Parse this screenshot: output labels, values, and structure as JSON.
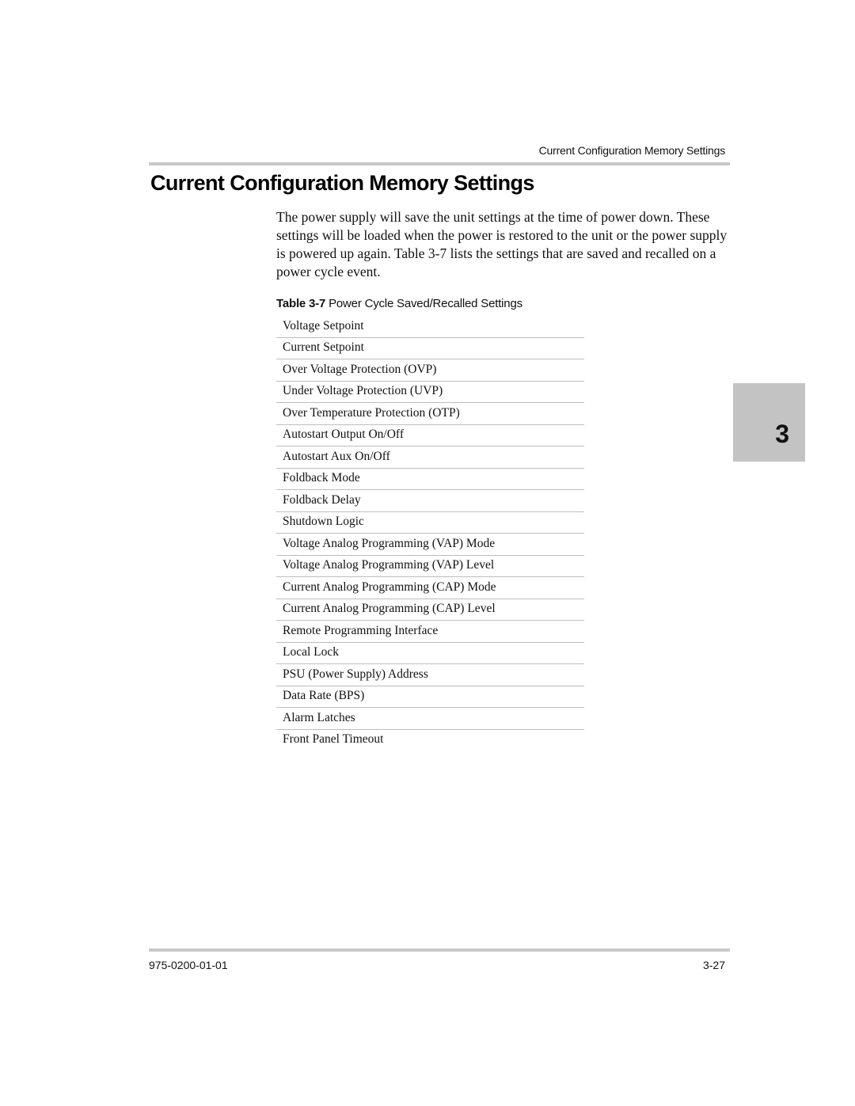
{
  "header": {
    "running_title": "Current Configuration Memory Settings"
  },
  "section": {
    "title": "Current Configuration Memory Settings",
    "body": "The power supply will save the unit settings at the time of power down. These settings will be loaded when the power is restored to the unit or the power supply is powered up again. Table 3-7 lists the settings that are saved and recalled on a power cycle event."
  },
  "table": {
    "caption_number": "Table 3-7",
    "caption_title": "Power Cycle Saved/Recalled Settings",
    "rows": [
      "Voltage Setpoint",
      "Current Setpoint",
      "Over Voltage Protection (OVP)",
      "Under Voltage Protection (UVP)",
      "Over Temperature Protection (OTP)",
      "Autostart Output On/Off",
      "Autostart Aux On/Off",
      "Foldback Mode",
      "Foldback Delay",
      "Shutdown Logic",
      "Voltage Analog Programming (VAP) Mode",
      "Voltage Analog Programming (VAP) Level",
      "Current Analog Programming (CAP) Mode",
      "Current Analog Programming (CAP) Level",
      "Remote Programming Interface",
      "Local Lock",
      "PSU (Power Supply) Address",
      "Data Rate (BPS)",
      "Alarm Latches",
      "Front Panel Timeout"
    ]
  },
  "chapter_tab": {
    "number": "3"
  },
  "footer": {
    "document_number": "975-0200-01-01",
    "page_number": "3-27"
  }
}
